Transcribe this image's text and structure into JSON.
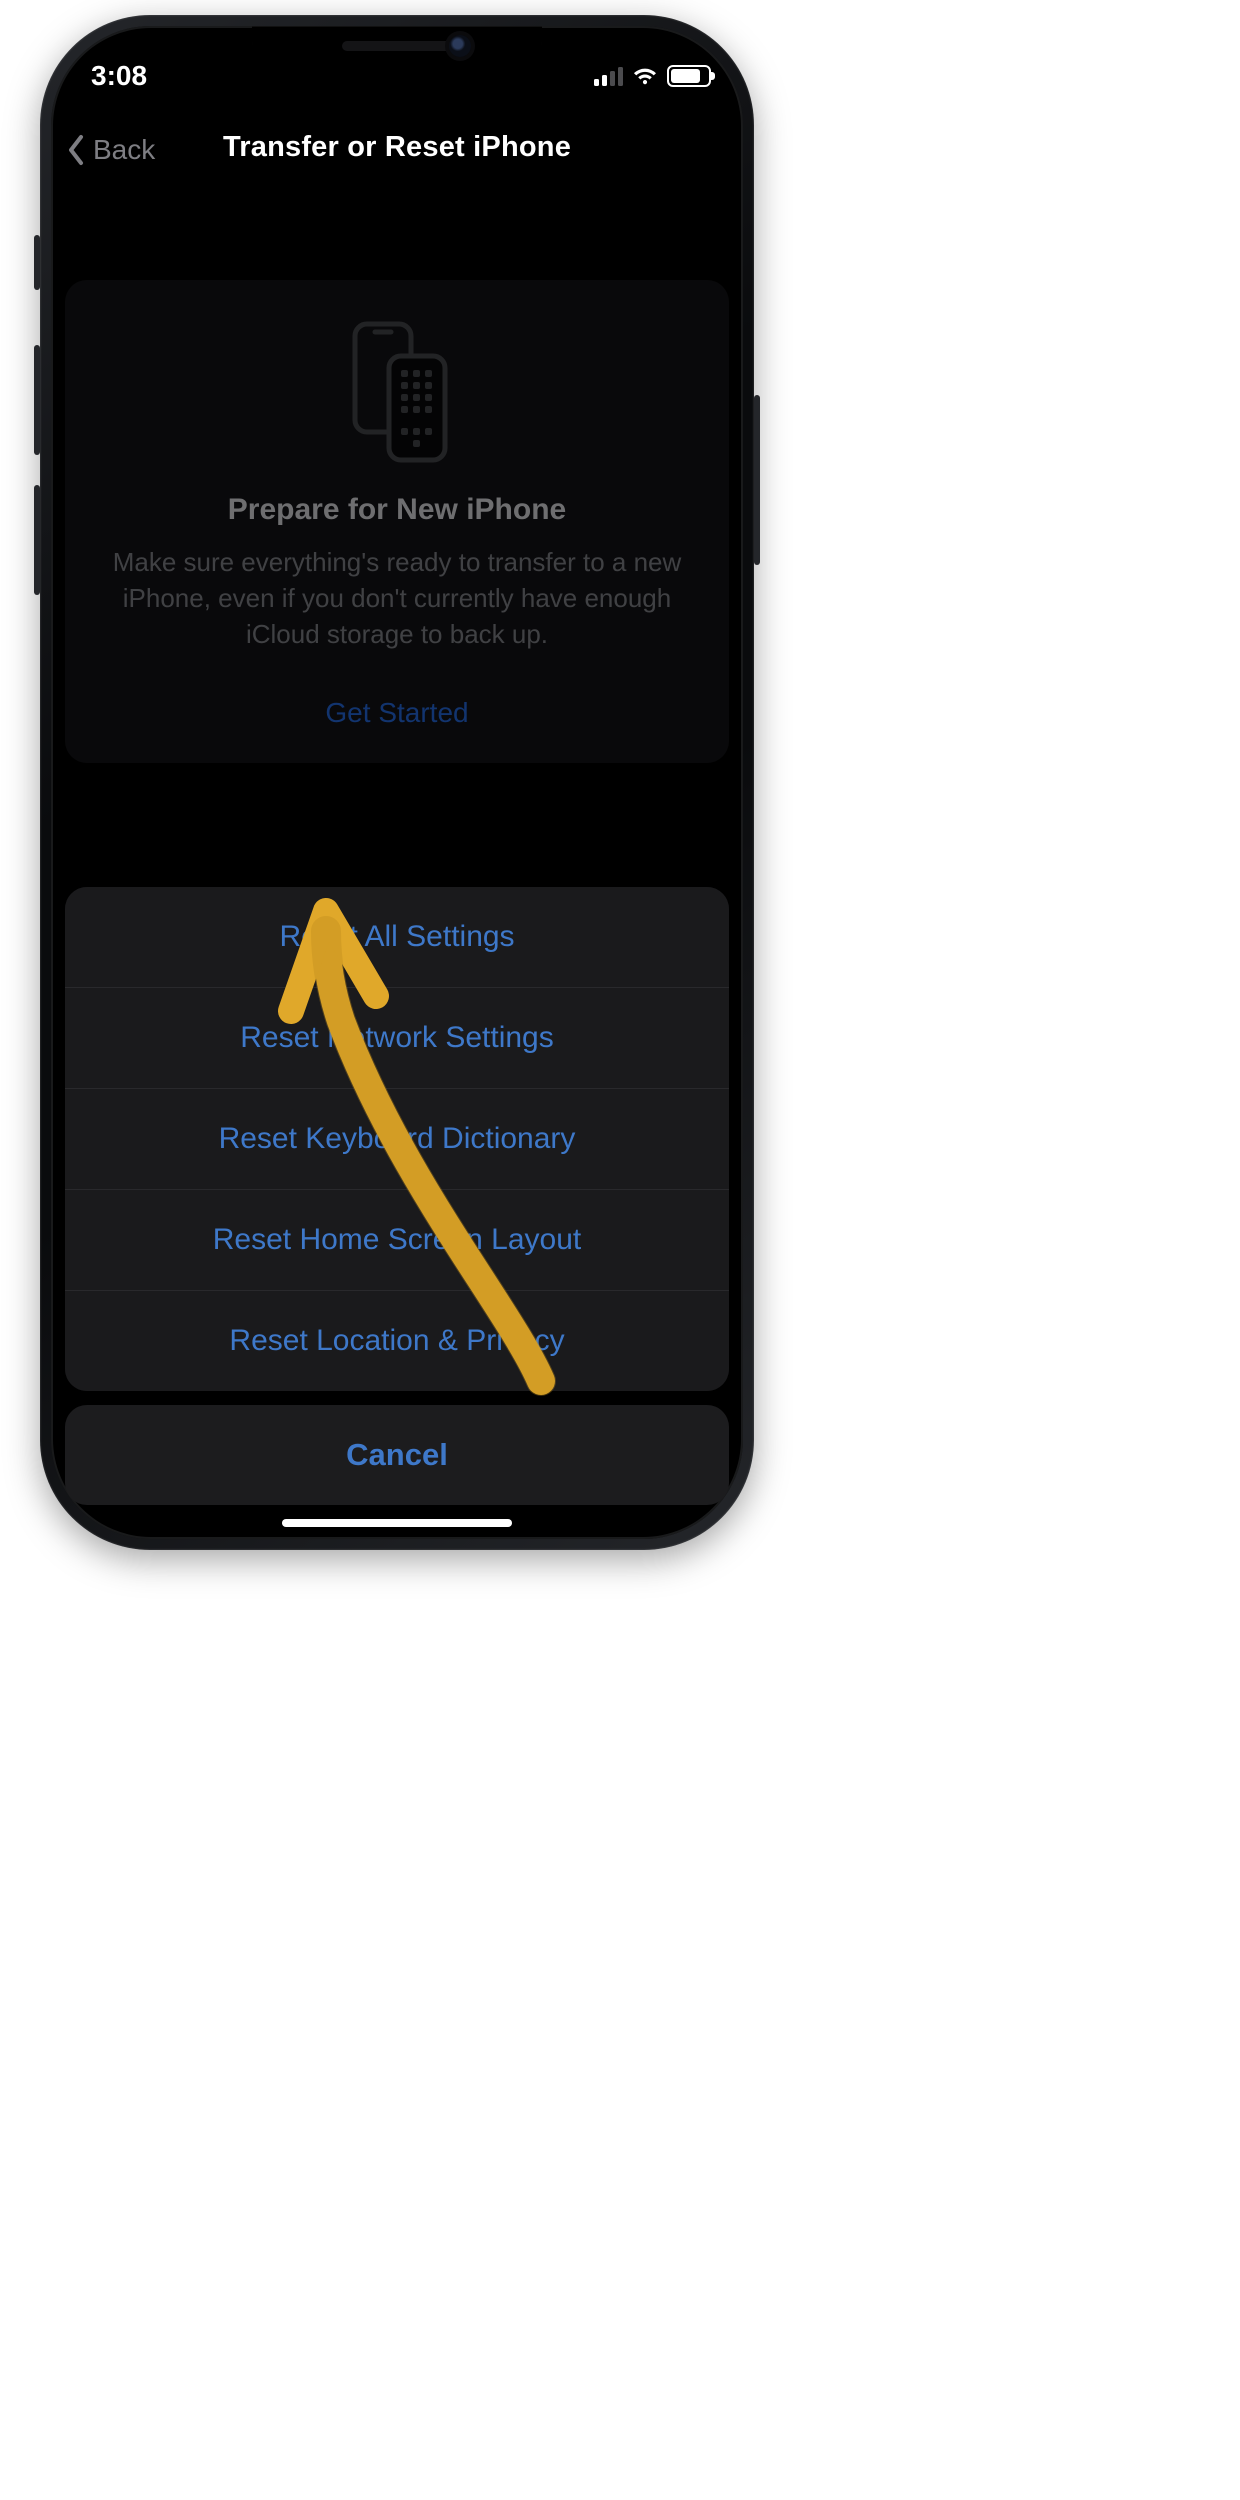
{
  "status": {
    "time": "3:08",
    "signal_bars_active": 2,
    "signal_bars_total": 4
  },
  "nav": {
    "back_label": "Back",
    "title": "Transfer or Reset iPhone"
  },
  "prepare_card": {
    "title": "Prepare for New iPhone",
    "body": "Make sure everything's ready to transfer to a new iPhone, even if you don't currently have enough iCloud storage to back up.",
    "cta_label": "Get Started"
  },
  "sheet": {
    "options": {
      "reset_all": "Reset All Settings",
      "reset_network": "Reset Network Settings",
      "reset_keyboard": "Reset Keyboard Dictionary",
      "reset_home": "Reset Home Screen Layout",
      "reset_location": "Reset Location & Privacy"
    },
    "cancel_label": "Cancel"
  }
}
